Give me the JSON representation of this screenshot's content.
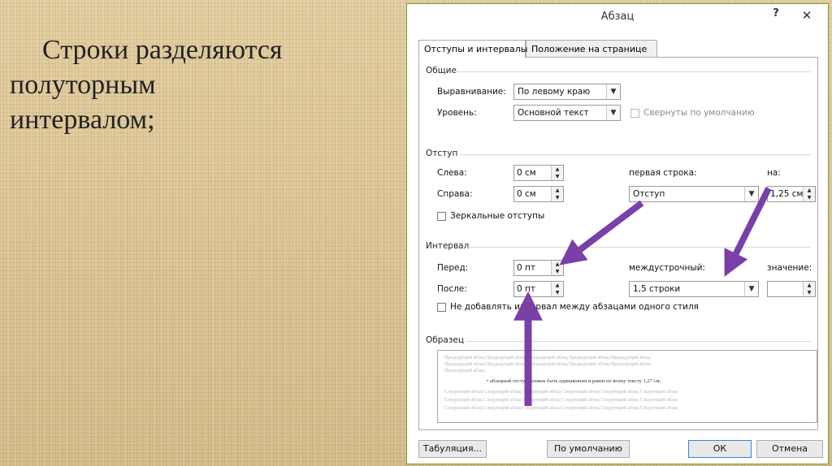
{
  "slide": {
    "text_lines": [
      "Строки разделяются",
      "полуторным",
      "интервалом;"
    ]
  },
  "dialog": {
    "title": "Абзац",
    "help": "?",
    "close": "✕",
    "tabs": [
      {
        "label": "Отступы и интервалы",
        "active": true
      },
      {
        "label": "Положение на странице",
        "active": false
      }
    ],
    "general": {
      "heading": "Общие",
      "alignment_label": "Выравнивание:",
      "alignment_value": "По левому краю",
      "level_label": "Уровень:",
      "level_value": "Основной текст",
      "collapsed_label": "Свернуты по умолчанию"
    },
    "indent": {
      "heading": "Отступ",
      "left_label": "Слева:",
      "left_value": "0 см",
      "right_label": "Справа:",
      "right_value": "0 см",
      "first_line_label": "первая строка:",
      "first_line_value": "Отступ",
      "by_label": "на:",
      "by_value": "1,25 см",
      "mirror_label": "Зеркальные отступы"
    },
    "spacing": {
      "heading": "Интервал",
      "before_label": "Перед:",
      "before_value": "0 пт",
      "after_label": "После:",
      "after_value": "0 пт",
      "line_label": "междустрочный:",
      "line_value": "1,5 строки",
      "at_label": "значение:",
      "at_value": "",
      "dont_add_label": "Не добавлять интервал между абзацами одного стиля"
    },
    "preview": {
      "heading": "Образец",
      "prev_line1": "Предыдущий абзац Предыдущий абзац Предыдущий абзац Предыдущий абзац Предыдущий абзац",
      "prev_line2": "Предыдущий абзац",
      "main_line": "• абзацный отступ должен быть одинаковым и равен по всему тексту 1,27 см;",
      "next_line1": "Следующий абзац Следующий абзац Следующий абзац Следующий абзац Следующий абзац Следующий абзац",
      "next_line2": "Следующий абзац Следующий абзац Следующий абзац Следующий абзац Следующий абзац Следующий абзац",
      "next_line3": "Следующий абзац Следующий абзац Следующий абзац Следующий абзац Следующий абзац Следующий абзац"
    },
    "buttons": {
      "tabs": "Табуляция...",
      "default": "По умолчанию",
      "ok": "ОК",
      "cancel": "Отмена"
    }
  },
  "colors": {
    "arrow": "#7b3fa8",
    "dialog_border": "#6fa63c",
    "ok_border": "#3b82d6"
  }
}
